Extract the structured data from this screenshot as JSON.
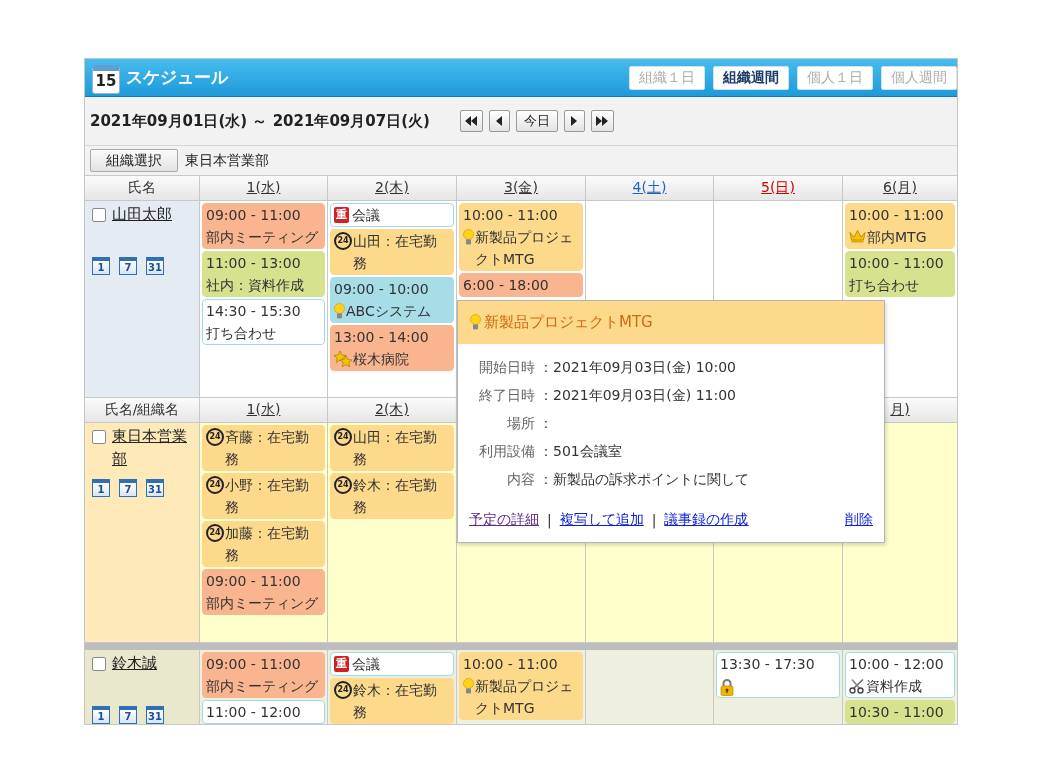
{
  "app": {
    "logo_day": "15",
    "title": "スケジュール"
  },
  "view_tabs": [
    {
      "label": "組織１日",
      "selected": false
    },
    {
      "label": "組織週間",
      "selected": true
    },
    {
      "label": "個人１日",
      "selected": false
    },
    {
      "label": "個人週間",
      "selected": false
    }
  ],
  "period": {
    "range": "2021年09月01日(水) ～ 2021年09月07日(火)",
    "nav": [
      {
        "kind": "first"
      },
      {
        "kind": "previous"
      },
      {
        "kind": "today",
        "label": "今日"
      },
      {
        "kind": "next"
      },
      {
        "kind": "last"
      }
    ]
  },
  "organization": {
    "button": "組織選択",
    "name": "東日本営業部"
  },
  "groups": [
    {
      "header": {
        "label": "氏名",
        "days": {
          "column_1": {
            "label": "1(水)",
            "kind": "weekday"
          },
          "column_2": {
            "label": "2(木)",
            "kind": "weekday"
          },
          "column_3": {
            "label": "3(金)",
            "kind": "weekday"
          },
          "column_4": {
            "label": "4(土)",
            "kind": "saturday"
          },
          "column_5": {
            "label": "5(日)",
            "kind": "sunday"
          },
          "column_6": {
            "label": "6(月)",
            "kind": "weekday"
          }
        }
      },
      "rows": [
        {
          "kind": "self",
          "name": "山田太郎",
          "checked": false,
          "calendar_links": [
            "1",
            "7",
            "31"
          ],
          "days": {
            "column_1": [
              {
                "kind": "plain",
                "color": "#f9b58f",
                "time": "09:00 - 11:00",
                "title": "部内ミーティング"
              },
              {
                "kind": "plain",
                "color": "#d6e28e",
                "time": "11:00 - 13:00",
                "title": "社内：資料作成"
              },
              {
                "kind": "plain",
                "color": "#ffffff",
                "time": "14:30 - 15:30",
                "title": "打ち合わせ"
              }
            ],
            "column_2": [
              {
                "kind": "priority",
                "badge": "重",
                "color": "#ffffff",
                "title": "会議"
              },
              {
                "kind": "repeat",
                "badge": "24",
                "color": "#fdd98b",
                "title": "山田：在宅勤務"
              },
              {
                "kind": "idea",
                "color": "#a7dde7",
                "time": "09:00 - 10:00",
                "title": "ABCシステム"
              },
              {
                "kind": "stars",
                "color": "#f9b58f",
                "time": "13:00 - 14:00",
                "title": "桜木病院"
              }
            ],
            "column_3": [
              {
                "kind": "idea",
                "color": "#fdd98b",
                "time": "10:00 - 11:00",
                "title": "新製品プロジェクトMTG"
              },
              {
                "kind": "plain",
                "color": "#f9b58f",
                "time": "6:00 - 18:00"
              }
            ],
            "column_6": [
              {
                "kind": "crown",
                "color": "#fdd98b",
                "time": "10:00 - 11:00",
                "title": "部内MTG"
              },
              {
                "kind": "plain",
                "color": "#d6e28e",
                "time": "10:00 - 11:00",
                "title": "打ち合わせ"
              }
            ]
          }
        }
      ]
    },
    {
      "header": {
        "label": "氏名/組織名",
        "days": {
          "column_1": {
            "label": "1(水)",
            "kind": "weekday"
          },
          "column_2": {
            "label": "2(木)",
            "kind": "weekday"
          },
          "column_6": {
            "label": "月)",
            "kind": "weekday"
          }
        }
      },
      "rows": [
        {
          "kind": "organization",
          "name": "東日本営業部",
          "checked": false,
          "calendar_links": [
            "1",
            "7",
            "31"
          ],
          "days": {
            "column_1": [
              {
                "kind": "repeat",
                "badge": "24",
                "color": "#fdd98b",
                "title": "斉藤：在宅勤務"
              },
              {
                "kind": "repeat",
                "badge": "24",
                "color": "#fdd98b",
                "title": "小野：在宅勤務"
              },
              {
                "kind": "repeat",
                "badge": "24",
                "color": "#fdd98b",
                "title": "加藤：在宅勤務"
              },
              {
                "kind": "plain",
                "color": "#f9b58f",
                "time": "09:00 - 11:00",
                "title": "部内ミーティング"
              }
            ],
            "column_2": [
              {
                "kind": "repeat",
                "badge": "24",
                "color": "#fdd98b",
                "title": "山田：在宅勤務"
              },
              {
                "kind": "repeat",
                "badge": "24",
                "color": "#fdd98b",
                "title": "鈴木：在宅勤務"
              }
            ]
          }
        },
        {
          "kind": "member",
          "name": "鈴木誠",
          "checked": false,
          "calendar_links": [
            "1",
            "7",
            "31"
          ],
          "days": {
            "column_1": [
              {
                "kind": "plain",
                "color": "#f9b58f",
                "time": "09:00 - 11:00",
                "title": "部内ミーティング"
              },
              {
                "kind": "plain",
                "color": "#ffffff",
                "time": "11:00 - 12:00"
              }
            ],
            "column_2": [
              {
                "kind": "priority",
                "badge": "重",
                "color": "#ffffff",
                "title": "会議"
              },
              {
                "kind": "repeat",
                "badge": "24",
                "color": "#fdd98b",
                "title": "鈴木：在宅勤務"
              }
            ],
            "column_3": [
              {
                "kind": "idea",
                "color": "#fdd98b",
                "time": "10:00 - 11:00",
                "title": "新製品プロジェクトMTG"
              }
            ],
            "column_5": [
              {
                "kind": "lock",
                "color": "#ffffff",
                "time": "13:30 - 17:30"
              }
            ],
            "column_6": [
              {
                "kind": "scissors",
                "color": "#ffffff",
                "time": "10:00 - 12:00",
                "title": "資料作成"
              },
              {
                "kind": "plain",
                "color": "#d6e28e",
                "time": "10:30 - 11:00"
              }
            ]
          }
        }
      ]
    }
  ],
  "popup": {
    "kind": "idea",
    "title": "新製品プロジェクトMTG",
    "fields": [
      {
        "label": "開始日時",
        "value": "：2021年09月03日(金) 10:00"
      },
      {
        "label": "終了日時",
        "value": "：2021年09月03日(金) 11:00"
      },
      {
        "label": "場所",
        "value": "："
      },
      {
        "label": "利用設備",
        "value": "：501会議室"
      },
      {
        "label": "内容",
        "value": "：新製品の訴求ポイントに関して"
      }
    ],
    "links": [
      {
        "label": "予定の詳細",
        "visited": true,
        "separator": "|"
      },
      {
        "label": "複写して追加",
        "visited": false,
        "separator": "|"
      },
      {
        "label": "議事録の作成",
        "visited": false
      }
    ],
    "delete_link": "削除"
  }
}
